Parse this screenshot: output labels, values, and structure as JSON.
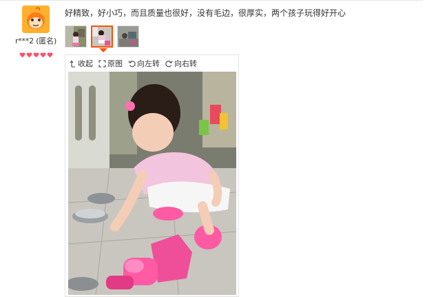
{
  "user": {
    "name": "r***2 (匿名)",
    "avatar_icon": "taobao-doll-avatar-icon",
    "level_icon": "heart-level-icon",
    "level_count": 5,
    "level_color": "#ff4d6a"
  },
  "review": {
    "text": "好精致，好小巧，而且质量也很好，没有毛边，很厚实，两个孩子玩得好开心"
  },
  "thumbnails": [
    {
      "name": "review-photo-1",
      "selected": false
    },
    {
      "name": "review-photo-2",
      "selected": true
    },
    {
      "name": "review-photo-3",
      "selected": false
    }
  ],
  "toolbar": {
    "collapse_label": "收起",
    "original_label": "原图",
    "rotate_left_label": "向左转",
    "rotate_right_label": "向右转"
  },
  "colors": {
    "accent": "#ff5000",
    "avatar_bg": "#ffb02e"
  }
}
